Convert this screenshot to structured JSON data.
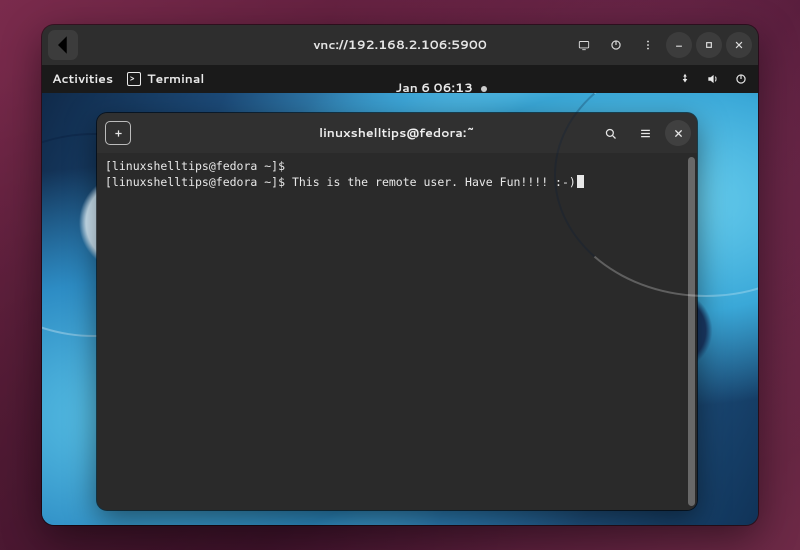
{
  "vnc": {
    "address": "vnc://192.168.2.106:5900"
  },
  "gnome": {
    "activities": "Activities",
    "app_label": "Terminal",
    "clock": "Jan 6  06:13"
  },
  "terminal": {
    "title": "linuxshelltips@fedora:~",
    "lines": [
      {
        "prompt": "[linuxshelltips@fedora ~]$",
        "text": ""
      },
      {
        "prompt": "[linuxshelltips@fedora ~]$",
        "text": " This is the remote user. Have Fun!!!! :-)"
      }
    ]
  }
}
